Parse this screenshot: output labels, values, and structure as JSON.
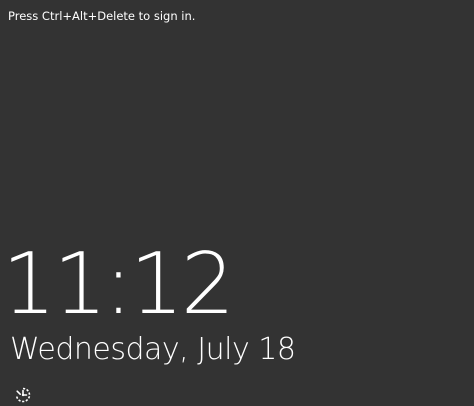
{
  "lock_screen": {
    "signin_hint": "Press Ctrl+Alt+Delete to sign in.",
    "time": "11:12",
    "date": "Wednesday, July 18",
    "ease_of_access_icon": "ease-of-access-icon",
    "background_color": "#333333",
    "text_color": "#ffffff"
  }
}
